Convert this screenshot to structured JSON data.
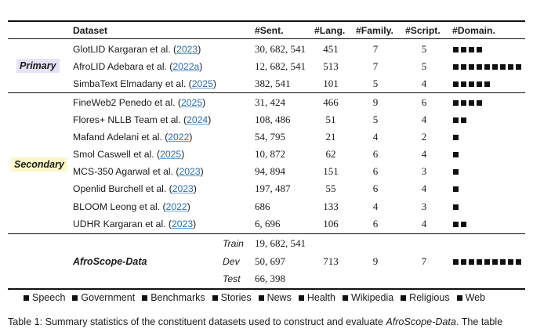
{
  "headers": {
    "dataset": "Dataset",
    "sent": "#Sent.",
    "lang": "#Lang.",
    "family": "#Family.",
    "script": "#Script.",
    "domain": "#Domain."
  },
  "groups": {
    "primary": "Primary",
    "secondary": "Secondary",
    "afroscope": "AfroScope-Data"
  },
  "rows": [
    {
      "name": "GlotLID Kargaran et al. (",
      "year": "2023",
      "sent": "30, 682, 541",
      "lang": "451",
      "family": "7",
      "script": "5",
      "domain_count": 4
    },
    {
      "name": "AfroLID Adebara et al. (",
      "year": "2022a",
      "sent": "12, 682, 541",
      "lang": "513",
      "family": "7",
      "script": "5",
      "domain_count": 9
    },
    {
      "name": "SimbaText Elmadany et al. (",
      "year": "2025",
      "sent": "382, 541",
      "lang": "101",
      "family": "5",
      "script": "4",
      "domain_count": 5
    },
    {
      "name": "FineWeb2 Penedo et al. (",
      "year": "2025",
      "sent": "31, 424",
      "lang": "466",
      "family": "9",
      "script": "6",
      "domain_count": 4
    },
    {
      "name": "Flores+ NLLB Team et al. (",
      "year": "2024",
      "sent": "108, 486",
      "lang": "51",
      "family": "5",
      "script": "4",
      "domain_count": 2
    },
    {
      "name": "Mafand Adelani et al. (",
      "year": "2022",
      "sent": "54, 795",
      "lang": "21",
      "family": "4",
      "script": "2",
      "domain_count": 1
    },
    {
      "name": "Smol Caswell et al. (",
      "year": "2025",
      "sent": "10, 872",
      "lang": "62",
      "family": "6",
      "script": "4",
      "domain_count": 1
    },
    {
      "name": "MCS-350 Agarwal et al. (",
      "year": "2023",
      "sent": "94, 894",
      "lang": "151",
      "family": "6",
      "script": "3",
      "domain_count": 1
    },
    {
      "name": "Openlid Burchell et al. (",
      "year": "2023",
      "sent": "197, 487",
      "lang": "55",
      "family": "6",
      "script": "4",
      "domain_count": 1
    },
    {
      "name": "BLOOM Leong et al. (",
      "year": "2022",
      "sent": "686",
      "lang": "133",
      "family": "4",
      "script": "3",
      "domain_count": 1
    },
    {
      "name": "UDHR Kargaran et al. (",
      "year": "2023",
      "sent": "6, 696",
      "lang": "106",
      "family": "6",
      "script": "4",
      "domain_count": 2
    }
  ],
  "afroscope": {
    "splits": [
      {
        "label": "Train",
        "sent": "19, 682, 541"
      },
      {
        "label": "Dev",
        "sent": "50, 697"
      },
      {
        "label": "Test",
        "sent": "66, 398"
      }
    ],
    "lang": "713",
    "family": "9",
    "script": "7",
    "domain_count": 9
  },
  "legend": [
    "Speech",
    "Government",
    "Benchmarks",
    "Stories",
    "News",
    "Health",
    "Wikipedia",
    "Religious",
    "Web"
  ],
  "caption": {
    "prefix": "Table 1: Summary statistics of the constituent datasets used to construct and evaluate ",
    "emph": "AfroScope-Data",
    "suffix": ". The table"
  },
  "colors": {
    "primary_highlight": "#e6e2f7",
    "secondary_highlight": "#fbf7c6",
    "citation": "#2b6cb0"
  }
}
